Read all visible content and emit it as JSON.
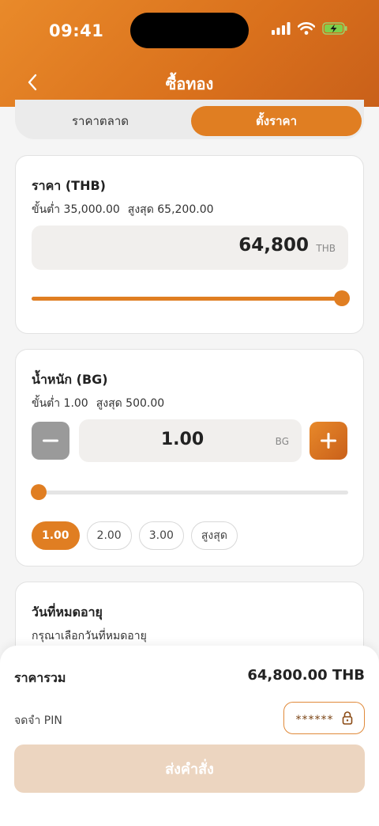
{
  "status_bar": {
    "time": "09:41"
  },
  "header": {
    "title": "ซื้อทอง"
  },
  "segment": {
    "tabs": [
      "ราคาตลาด",
      "ตั้งราคา"
    ],
    "selected": 1
  },
  "price_card": {
    "title": "ราคา (THB)",
    "min_text": "ขั้นต่ำ 35,000.00",
    "max_text": "สูงสุด 65,200.00",
    "value": "64,800",
    "unit": "THB",
    "slider_fraction": 0.98
  },
  "weight_card": {
    "title": "น้ำหนัก (BG)",
    "min_text": "ขั้นต่ำ 1.00",
    "max_text": "สูงสุด 500.00",
    "value": "1.00",
    "unit": "BG",
    "slider_fraction": 0.0,
    "chips": [
      "1.00",
      "2.00",
      "3.00",
      "สูงสุด"
    ],
    "selected_chip": 0
  },
  "expiry_card": {
    "title": "วันที่หมดอายุ",
    "subtitle": "กรุณาเลือกวันที่หมดอายุ"
  },
  "summary": {
    "total_label": "ราคารวม",
    "total_value": "64,800.00 THB",
    "pin_label": "จดจำ PIN",
    "pin_mask": "******",
    "submit_label": "ส่งคำสั่ง"
  },
  "colors": {
    "accent": "#e07e22",
    "header": "#d9701c",
    "submit_disabled": "#ecd5c0"
  }
}
